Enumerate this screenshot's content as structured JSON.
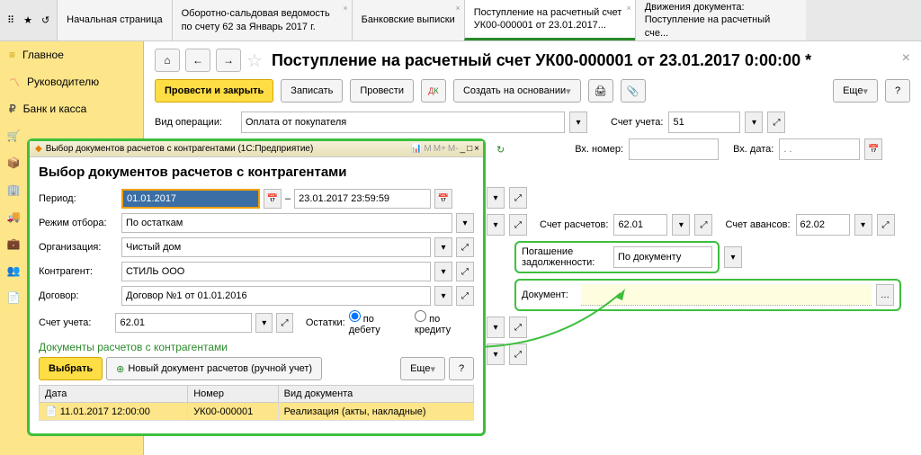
{
  "tabs": [
    {
      "label": "Начальная страница"
    },
    {
      "label": "Оборотно-сальдовая ведомость по счету 62 за Январь 2017 г."
    },
    {
      "label": "Банковские выписки"
    },
    {
      "label": "Поступление на расчетный счет УК00-000001 от 23.01.2017..."
    },
    {
      "label": "Движения документа: Поступление на расчетный сче..."
    }
  ],
  "sidebar": {
    "items": [
      {
        "label": "Главное",
        "icon": "menu"
      },
      {
        "label": "Руководителю",
        "icon": "chart"
      },
      {
        "label": "Банк и касса",
        "icon": "ruble"
      }
    ]
  },
  "page": {
    "title": "Поступление на расчетный счет УК00-000001 от 23.01.2017 0:00:00 *",
    "actions": {
      "post_close": "Провести и закрыть",
      "save": "Записать",
      "post": "Провести",
      "create_based": "Создать на основании",
      "more": "Еще"
    },
    "fields": {
      "operation_type_label": "Вид операции:",
      "operation_type": "Оплата от покупателя",
      "account_label": "Счет учета:",
      "account": "51",
      "in_number_label": "Вх. номер:",
      "in_date_label": "Вх. дата:",
      "in_date_placeholder": ". .",
      "settlement_account_label": "Счет расчетов:",
      "settlement_account": "62.01",
      "advance_account_label": "Счет авансов:",
      "advance_account": "62.02",
      "debt_repay_label": "Погашение задолженности:",
      "debt_repay": "По документу",
      "document_label": "Документ:"
    }
  },
  "dialog": {
    "window_title": "Выбор документов расчетов с контрагентами  (1С:Предприятие)",
    "title": "Выбор документов расчетов с контрагентами",
    "labels": {
      "period": "Период:",
      "selection_mode": "Режим отбора:",
      "organization": "Организация:",
      "counterparty": "Контрагент:",
      "contract": "Договор:",
      "account": "Счет учета:",
      "balances": "Остатки:",
      "by_debit": "по дебету",
      "by_credit": "по кредиту"
    },
    "values": {
      "period_from": "01.01.2017",
      "period_to": "23.01.2017 23:59:59",
      "selection_mode": "По остаткам",
      "organization": "Чистый дом",
      "counterparty": "СТИЛЬ ООО",
      "contract": "Договор №1 от 01.01.2016",
      "account": "62.01"
    },
    "section_title": "Документы расчетов с контрагентами",
    "buttons": {
      "select": "Выбрать",
      "new_doc": "Новый документ расчетов (ручной учет)",
      "more": "Еще"
    },
    "table": {
      "headers": {
        "date": "Дата",
        "number": "Номер",
        "doctype": "Вид документа"
      },
      "rows": [
        {
          "date": "11.01.2017 12:00:00",
          "number": "УК00-000001",
          "doctype": "Реализация (акты, накладные)"
        }
      ]
    }
  }
}
